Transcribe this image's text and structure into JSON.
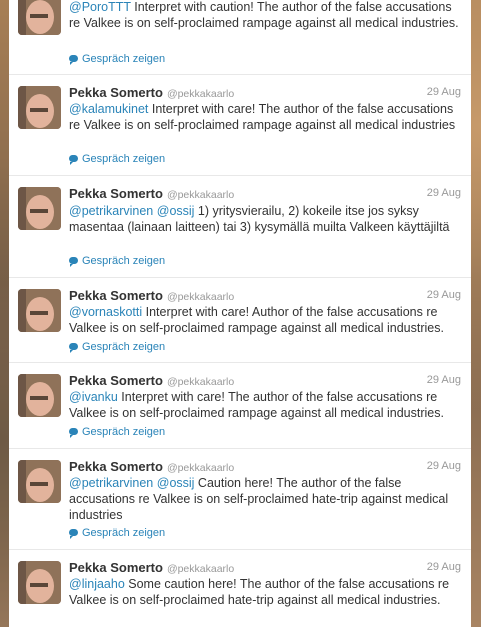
{
  "tweets": [
    {
      "name": "",
      "handle": "",
      "date": "",
      "mentions": [
        "@PoroTTT"
      ],
      "text": " Interpret with caution! The author of the false accusations re Valkee is on self-proclaimed rampage against all medical industries.",
      "conversation_label": "Gespräch zeigen"
    },
    {
      "name": "Pekka Somerto",
      "handle": "@pekkakaarlo",
      "date": "29 Aug",
      "mentions": [
        "@kalamukinet"
      ],
      "text": " Interpret with care! The author of the false accusations re Valkee is on self-proclaimed rampage against all medical industries",
      "conversation_label": "Gespräch zeigen"
    },
    {
      "name": "Pekka Somerto",
      "handle": "@pekkakaarlo",
      "date": "29 Aug",
      "mentions": [
        "@petrikarvinen",
        "@ossij"
      ],
      "text": " 1) yritysvierailu, 2) kokeile itse jos syksy masentaa (lainaan laitteen) tai 3) kysymällä muilta Valkeen käyttäjiltä",
      "conversation_label": "Gespräch zeigen"
    },
    {
      "name": "Pekka Somerto",
      "handle": "@pekkakaarlo",
      "date": "29 Aug",
      "mentions": [
        "@vornaskotti"
      ],
      "text": " Interpret with care! Author of the false accusations re Valkee is on self-proclaimed rampage against all medical industries.",
      "conversation_label": "Gespräch zeigen"
    },
    {
      "name": "Pekka Somerto",
      "handle": "@pekkakaarlo",
      "date": "29 Aug",
      "mentions": [
        "@ivanku"
      ],
      "text": " Interpret with care! The author of the false accusations re Valkee is on self-proclaimed rampage against all medical industries.",
      "conversation_label": "Gespräch zeigen"
    },
    {
      "name": "Pekka Somerto",
      "handle": "@pekkakaarlo",
      "date": "29 Aug",
      "mentions": [
        "@petrikarvinen",
        "@ossij"
      ],
      "text": " Caution here! The author of the false accusations re Valkee is on self-proclaimed hate-trip against medical industries",
      "conversation_label": "Gespräch zeigen"
    },
    {
      "name": "Pekka Somerto",
      "handle": "@pekkakaarlo",
      "date": "29 Aug",
      "mentions": [
        "@linjaaho"
      ],
      "text": " Some caution here! The author of the false accusations re Valkee is on self-proclaimed hate-trip against all medical industries.",
      "conversation_label": ""
    }
  ],
  "icons": {
    "avatar": "profile-photo",
    "conversation": "speech-bubble-icon"
  },
  "colors": {
    "link": "#2a84b8",
    "text": "#333333",
    "meta": "#999999"
  }
}
